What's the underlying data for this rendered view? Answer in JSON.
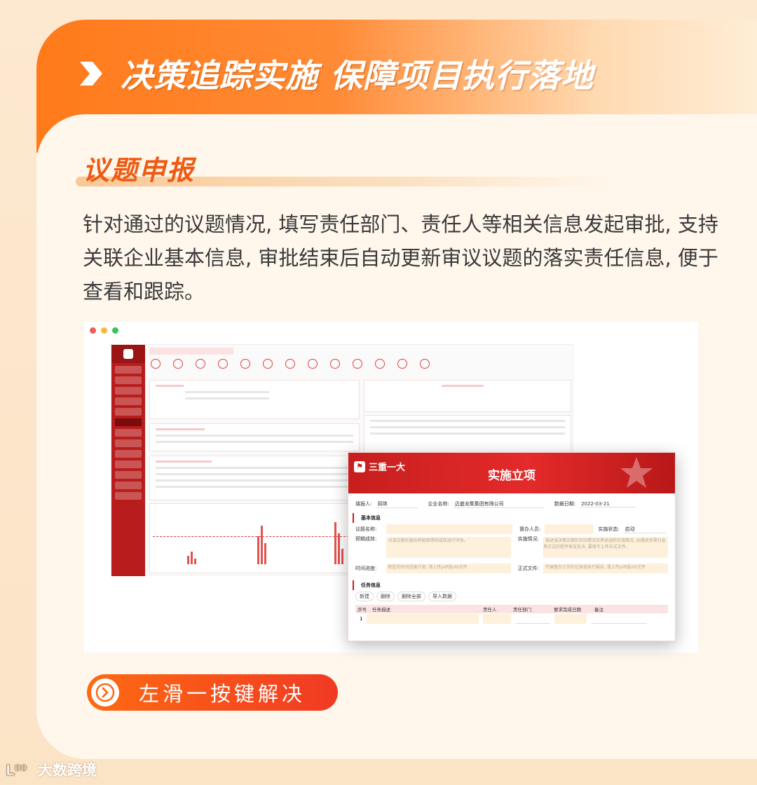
{
  "headline": "决策追踪实施  保障项目执行落地",
  "section_title": "议题申报",
  "description": "针对通过的议题情况, 填写责任部门、责任人等相关信息发起审批, 支持关联企业基本信息, 审批结束后自动更新审议议题的落实责任信息, 便于查看和跟踪。",
  "dialog": {
    "logo_text": "三重一大",
    "title": "实施立项",
    "filler_label": "填报人:",
    "filler_value": "周琪",
    "company_label": "企业名称:",
    "company_value": "迈盛龙集集团有限公司",
    "date_label": "数据日期:",
    "date_value": "2022-03-21",
    "section_basic": "基本信息",
    "topic_name_label": "议题名称:",
    "handler_label": "督办人员:",
    "status_label": "实施状态:",
    "status_value": "启动",
    "expected_label": "预期成效:",
    "expected_placeholder": "对该议题实施后将能取得的成效进行评估。",
    "situation_label": "实施情况:",
    "situation_placeholder": "描述该决策议题的实际情况及具体组织实施情况, 如遇改变需分会具正式的程序审议及决, 要填写上传正式文件。",
    "schedule_label": "时间进度:",
    "schedule_placeholder": "制定的时间进度计划, 请上传pdf或ofd文件",
    "official_label": "正式文件:",
    "official_placeholder": "开展督办工作的记录或执行报告, 请上传pdf或ofd文件",
    "section_tasks": "任务信息",
    "buttons": [
      "新建",
      "删除",
      "删除全部",
      "导入数据"
    ],
    "table_headers": [
      "序号",
      "任务描述",
      "责任人",
      "责任部门",
      "要求完成日期",
      "备注"
    ],
    "row_index": "1"
  },
  "cta_text": "左滑一按键解决",
  "watermark": "大数跨境",
  "colors": {
    "accent_orange": "#ff6a12",
    "accent_red": "#c71e1e",
    "title_orange": "#ef5a12"
  }
}
